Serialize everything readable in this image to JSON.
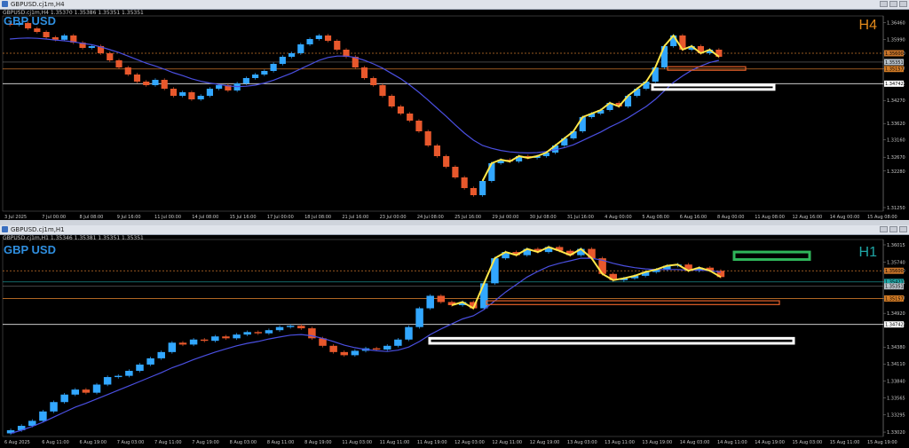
{
  "colors": {
    "up": "#32a7ff",
    "down": "#e8582c",
    "ma": "#4a4fe0",
    "wave": "#ffe74a",
    "orange_line": "#c8742a",
    "white_line": "#e8e8e8",
    "zone_orange": "#e8622a",
    "zone_white": "#ffffff",
    "zone_green": "#2fb55a",
    "h4_color": "#e2891b",
    "h1_color": "#1fa7a7"
  },
  "top": {
    "window_title": "GBPUSD.cj1m,H4",
    "ohlc": "GBPUSD.cj1m,H4  1.35370 1.35386 1.35351 1.35351",
    "symbol": "GBP USD",
    "timeframe": "H4",
    "tags": {
      "r1": "1.35600",
      "r2": "1.35351",
      "r3": "1.35157",
      "s1": "1.34742"
    },
    "chart_data": {
      "type": "candlestick",
      "price_axis": [
        "1.36460",
        "1.35990",
        "1.35600",
        "1.35157",
        "1.34742",
        "1.34270",
        "1.33620",
        "1.33160",
        "1.32670",
        "1.32280",
        "1.31250"
      ],
      "ylim": [
        1.3115,
        1.3665
      ],
      "x_labels": [
        "3 Jul 2025",
        "7 Jul 00:00",
        "8 Jul 08:00",
        "9 Jul 16:00",
        "11 Jul 00:00",
        "14 Jul 08:00",
        "15 Jul 16:00",
        "17 Jul 00:00",
        "18 Jul 08:00",
        "21 Jul 16:00",
        "23 Jul 00:00",
        "24 Jul 08:00",
        "25 Jul 16:00",
        "29 Jul 00:00",
        "30 Jul 08:00",
        "31 Jul 16:00",
        "4 Aug 00:00",
        "5 Aug 08:00",
        "6 Aug 16:00",
        "8 Aug 00:00",
        "11 Aug 08:00",
        "12 Aug 16:00",
        "14 Aug 00:00",
        "15 Aug 08:00"
      ],
      "closes": [
        1.364,
        1.3645,
        1.363,
        1.362,
        1.3605,
        1.3598,
        1.361,
        1.359,
        1.3575,
        1.358,
        1.356,
        1.354,
        1.352,
        1.35,
        1.348,
        1.347,
        1.3485,
        1.346,
        1.344,
        1.345,
        1.343,
        1.344,
        1.346,
        1.347,
        1.3455,
        1.3475,
        1.349,
        1.35,
        1.351,
        1.353,
        1.355,
        1.356,
        1.3585,
        1.36,
        1.361,
        1.3595,
        1.357,
        1.355,
        1.352,
        1.349,
        1.347,
        1.344,
        1.341,
        1.339,
        1.337,
        1.334,
        1.33,
        1.327,
        1.324,
        1.321,
        1.318,
        1.316,
        1.32,
        1.325,
        1.326,
        1.3255,
        1.327,
        1.3265,
        1.327,
        1.328,
        1.33,
        1.332,
        1.334,
        1.338,
        1.339,
        1.34,
        1.342,
        1.341,
        1.344,
        1.346,
        1.348,
        1.352,
        1.358,
        1.361,
        1.357,
        1.358,
        1.356,
        1.357,
        1.355
      ],
      "ma": [
        1.36,
        1.3602,
        1.3603,
        1.3602,
        1.36,
        1.3597,
        1.3595,
        1.3592,
        1.3588,
        1.3584,
        1.3578,
        1.357,
        1.3562,
        1.3552,
        1.3542,
        1.3532,
        1.3524,
        1.3515,
        1.3505,
        1.3497,
        1.3488,
        1.3481,
        1.3476,
        1.3472,
        1.3468,
        1.3466,
        1.3467,
        1.347,
        1.3476,
        1.3484,
        1.3494,
        1.3504,
        1.3516,
        1.3528,
        1.354,
        1.3548,
        1.3552,
        1.3552,
        1.3548,
        1.354,
        1.353,
        1.3518,
        1.3503,
        1.3488,
        1.347,
        1.345,
        1.3428,
        1.3405,
        1.3382,
        1.3358,
        1.3335,
        1.3315,
        1.33,
        1.3292,
        1.3286,
        1.3282,
        1.328,
        1.3279,
        1.328,
        1.3283,
        1.3288,
        1.3294,
        1.3302,
        1.3314,
        1.3326,
        1.3338,
        1.3352,
        1.3364,
        1.3378,
        1.3394,
        1.341,
        1.343,
        1.3454,
        1.3478,
        1.3496,
        1.3512,
        1.3524,
        1.3534,
        1.354
      ]
    }
  },
  "bottom": {
    "window_title": "GBPUSD.cj1m,H1",
    "ohlc": "GBPUSD.cj1m,H1  1.35346 1.35381 1.35351 1.35351",
    "symbol": "GBP USD",
    "timeframe": "H1",
    "tags": {
      "r1": "1.35600",
      "r2": "1.35421",
      "r3": "1.35351",
      "r4": "1.35157",
      "s1": "1.34742"
    },
    "chart_data": {
      "type": "candlestick",
      "price_axis": [
        "1.36015",
        "1.35740",
        "1.35600",
        "1.35421",
        "1.35157",
        "1.34920",
        "1.34742",
        "1.34380",
        "1.34110",
        "1.33840",
        "1.33565",
        "1.33295",
        "1.33020"
      ],
      "ylim": [
        1.3295,
        1.361
      ],
      "x_labels": [
        "6 Aug 2025",
        "6 Aug 11:00",
        "6 Aug 19:00",
        "7 Aug 03:00",
        "7 Aug 11:00",
        "7 Aug 19:00",
        "8 Aug 03:00",
        "8 Aug 11:00",
        "8 Aug 19:00",
        "11 Aug 03:00",
        "11 Aug 11:00",
        "11 Aug 19:00",
        "12 Aug 03:00",
        "12 Aug 11:00",
        "12 Aug 19:00",
        "13 Aug 03:00",
        "13 Aug 11:00",
        "13 Aug 19:00",
        "14 Aug 03:00",
        "14 Aug 11:00",
        "14 Aug 19:00",
        "15 Aug 03:00",
        "15 Aug 11:00",
        "15 Aug 19:00"
      ],
      "closes": [
        1.3305,
        1.3312,
        1.332,
        1.3335,
        1.335,
        1.3362,
        1.337,
        1.3365,
        1.3378,
        1.339,
        1.3392,
        1.34,
        1.341,
        1.342,
        1.343,
        1.3445,
        1.3442,
        1.345,
        1.3448,
        1.3455,
        1.3452,
        1.3458,
        1.3462,
        1.346,
        1.3465,
        1.347,
        1.3472,
        1.3468,
        1.3452,
        1.344,
        1.343,
        1.3425,
        1.3432,
        1.3436,
        1.3434,
        1.344,
        1.345,
        1.347,
        1.35,
        1.352,
        1.351,
        1.3505,
        1.351,
        1.35,
        1.354,
        1.358,
        1.359,
        1.3585,
        1.3595,
        1.359,
        1.3598,
        1.3592,
        1.3585,
        1.3595,
        1.358,
        1.3555,
        1.3545,
        1.3548,
        1.3552,
        1.3558,
        1.3562,
        1.3568,
        1.357,
        1.356,
        1.3565,
        1.356,
        1.355
      ],
      "ma": [
        1.33,
        1.3305,
        1.3311,
        1.3318,
        1.3326,
        1.3334,
        1.3342,
        1.3348,
        1.3355,
        1.3362,
        1.3369,
        1.3376,
        1.3383,
        1.339,
        1.3397,
        1.3405,
        1.3411,
        1.3418,
        1.3424,
        1.343,
        1.3435,
        1.344,
        1.3444,
        1.3447,
        1.3451,
        1.3454,
        1.3457,
        1.3458,
        1.3456,
        1.3452,
        1.3447,
        1.3441,
        1.3437,
        1.3434,
        1.3432,
        1.3431,
        1.3433,
        1.3438,
        1.3447,
        1.3458,
        1.3467,
        1.3475,
        1.3483,
        1.3488,
        1.3498,
        1.3512,
        1.3526,
        1.3538,
        1.355,
        1.3559,
        1.3567,
        1.3572,
        1.3576,
        1.358,
        1.358,
        1.3577,
        1.3572,
        1.3568,
        1.3565,
        1.3563,
        1.3562,
        1.3562,
        1.3562,
        1.3561,
        1.3561,
        1.356,
        1.3558
      ]
    }
  }
}
